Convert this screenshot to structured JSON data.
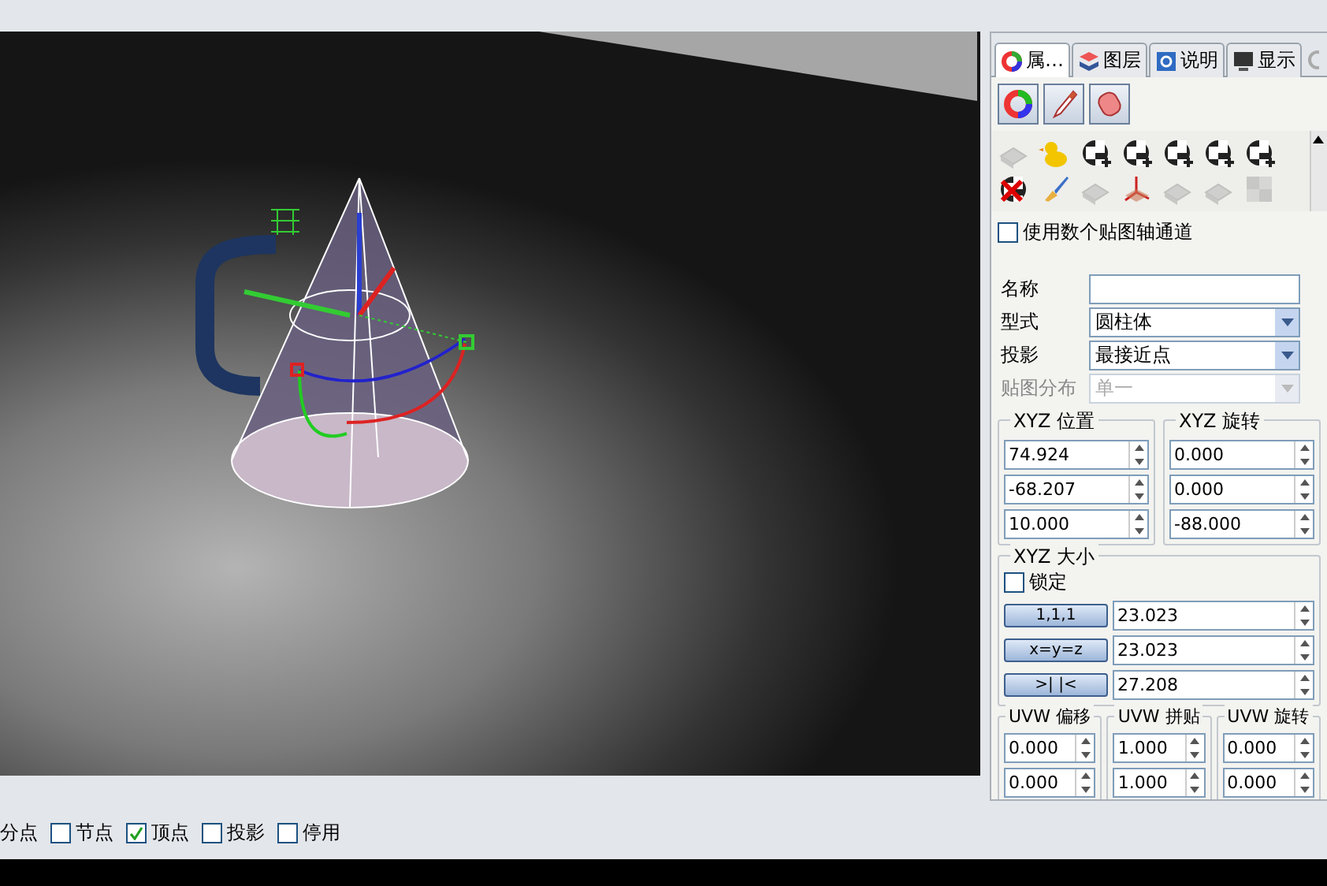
{
  "panel": {
    "tabs": [
      {
        "label": "属…",
        "selected": true
      },
      {
        "label": "图层",
        "selected": false
      },
      {
        "label": "说明",
        "selected": false
      },
      {
        "label": "显示",
        "selected": false
      }
    ],
    "multi_channel": {
      "label": "使用数个贴图轴通道",
      "checked": false
    },
    "fields": [
      {
        "label": "名称",
        "kind": "text",
        "disabled": false
      },
      {
        "label": "型式",
        "kind": "select",
        "value": "圆柱体",
        "disabled": false
      },
      {
        "label": "投影",
        "kind": "select",
        "value": "最接近点",
        "disabled": false
      },
      {
        "label": "贴图分布",
        "kind": "select",
        "value": "单一",
        "disabled": true
      }
    ],
    "xyz_groups": [
      {
        "title": "XYZ 位置",
        "values": [
          "74.924",
          "-68.207",
          "10.000"
        ]
      },
      {
        "title": "XYZ 旋转",
        "values": [
          "0.000",
          "0.000",
          "-88.000"
        ]
      }
    ],
    "xyz_size": {
      "title": "XYZ 大小",
      "lock": {
        "label": "锁定",
        "checked": false
      },
      "rows": [
        {
          "button": "1,1,1",
          "value": "23.023"
        },
        {
          "button": "x=y=z",
          "value": "23.023"
        },
        {
          "button": ">| |<",
          "value": "27.208"
        }
      ]
    },
    "uvw_groups": [
      {
        "title": "UVW 偏移",
        "values": [
          "0.000",
          "0.000"
        ]
      },
      {
        "title": "UVW 拼贴",
        "values": [
          "1.000",
          "1.000"
        ]
      },
      {
        "title": "UVW 旋转",
        "values": [
          "0.000",
          "0.000"
        ]
      }
    ]
  },
  "status_bar": {
    "partial_label": "分点",
    "options": [
      {
        "label": "节点",
        "checked": false
      },
      {
        "label": "顶点",
        "checked": true
      },
      {
        "label": "投影",
        "checked": false
      },
      {
        "label": "停用",
        "checked": false
      }
    ]
  }
}
